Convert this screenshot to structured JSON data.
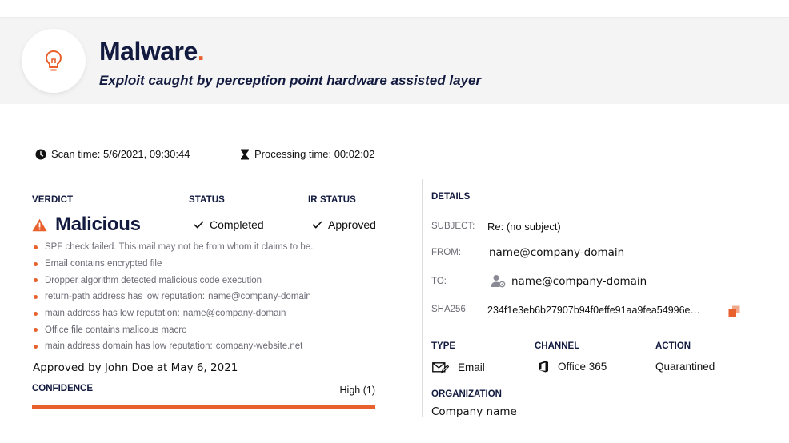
{
  "header": {
    "title": "Malware",
    "title_dot": ".",
    "subtitle": "Exploit caught by perception point hardware assisted layer",
    "icon": "lightbulb-icon"
  },
  "meta": {
    "scan_time": "Scan time: 5/6/2021, 09:30:44",
    "processing_time": "Processing time: 00:02:02"
  },
  "verdict": {
    "label": "VERDICT",
    "value": "Malicious",
    "icon": "warning-icon"
  },
  "status": {
    "label": "STATUS",
    "value": "Completed"
  },
  "ir_status": {
    "label": "IR STATUS",
    "value": "Approved"
  },
  "reasons": [
    {
      "text": "SPF check failed. This mail may not be from whom it claims to be.",
      "value": ""
    },
    {
      "text": "Email contains encrypted file",
      "value": ""
    },
    {
      "text": "Dropper algorithm detected malicious code execution",
      "value": ""
    },
    {
      "text": "return-path address has low reputation:",
      "value": "name@company-domain"
    },
    {
      "text": "main address has low reputation:",
      "value": "name@company-domain"
    },
    {
      "text": "Office file contains malicous macro",
      "value": ""
    },
    {
      "text": "main address domain has low reputation:",
      "value": "company-website.net"
    }
  ],
  "approved_by": "Approved by John Doe at May 6, 2021",
  "confidence": {
    "label": "CONFIDENCE",
    "value": "High (1)",
    "level": 1.0
  },
  "details": {
    "label": "DETAILS",
    "subject_label": "SUBJECT:",
    "subject": "Re: (no subject)",
    "from_label": "FROM:",
    "from": "name@company-domain",
    "to_label": "TO:",
    "to": "name@company-domain",
    "sha_label": "SHA256",
    "sha": "234f1e3eb6b27907b94f0effe91aa9fea54996e…",
    "type_label": "TYPE",
    "type": "Email",
    "channel_label": "CHANNEL",
    "channel": "Office 365",
    "action_label": "ACTION",
    "action": "Quarantined",
    "org_label": "ORGANIZATION",
    "org": "Company name"
  },
  "colors": {
    "accent": "#e8602c",
    "navy": "#131a3f",
    "header_bg": "#f4f4f5"
  }
}
